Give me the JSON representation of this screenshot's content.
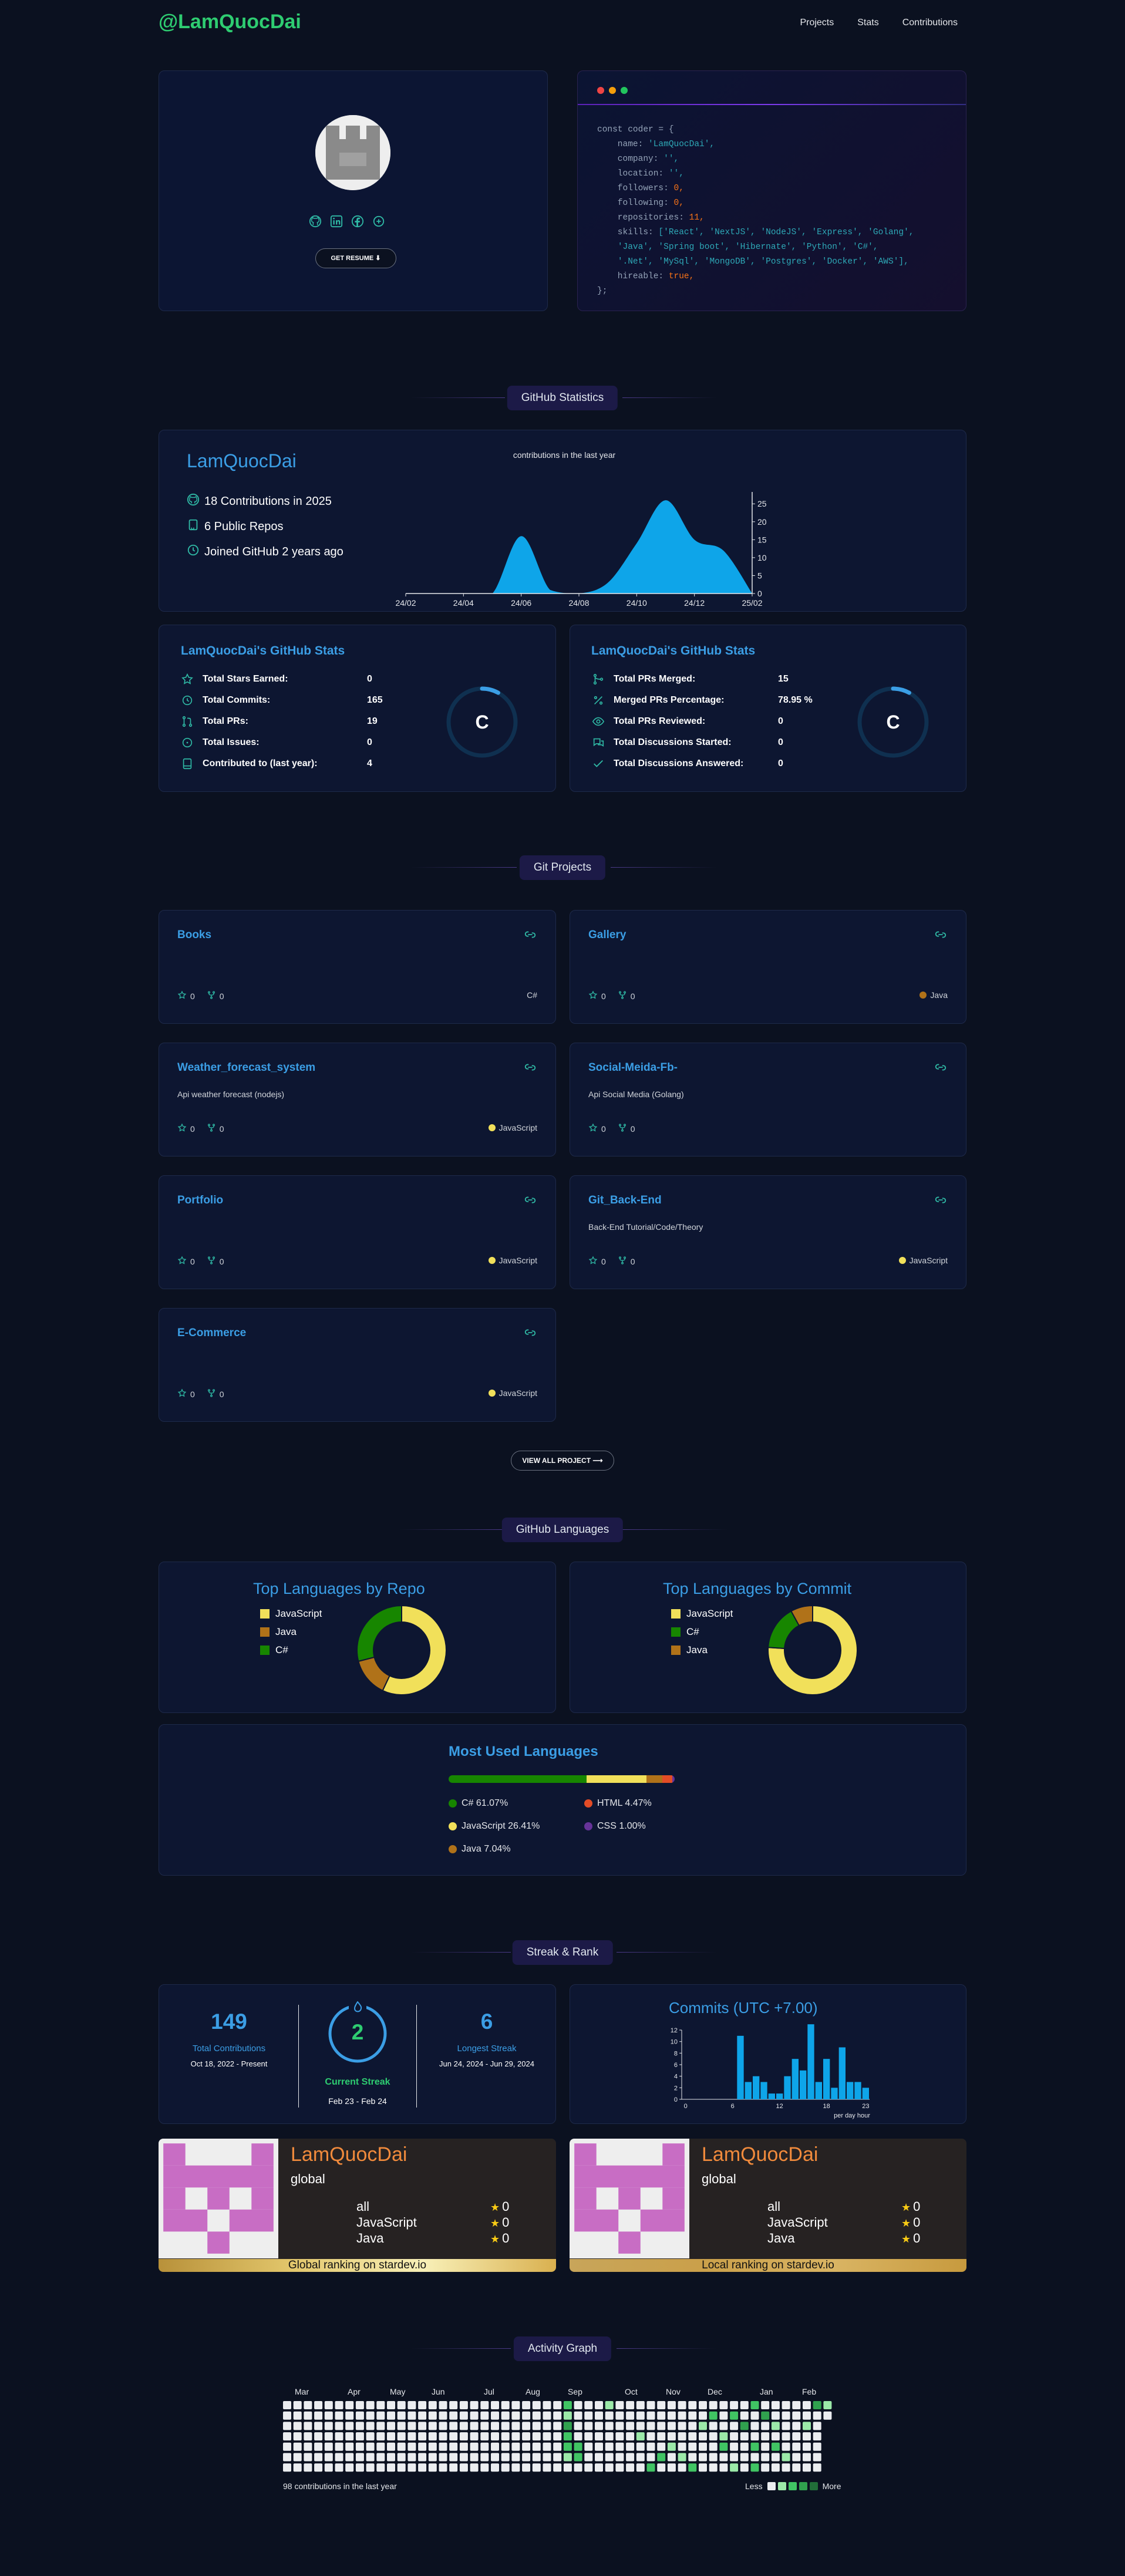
{
  "nav": {
    "logo": "@LamQuocDai",
    "links": [
      "Projects",
      "Stats",
      "Contributions"
    ]
  },
  "profile": {
    "resume_label": "GET RESUME",
    "socials": [
      "github-icon",
      "linkedin-icon",
      "facebook-icon",
      "stackoverflow-icon"
    ]
  },
  "code": {
    "lines": [
      {
        "k": "const coder = {"
      },
      {
        "k": "    name: ",
        "s": "'LamQuocDai',"
      },
      {
        "k": "    company: ",
        "s": "'',"
      },
      {
        "k": "    location: ",
        "s": "'',"
      },
      {
        "k": "    followers: ",
        "n": "0,"
      },
      {
        "k": "    following: ",
        "n": "0,"
      },
      {
        "k": "    repositories: ",
        "n": "11,"
      },
      {
        "k": "    skills: ",
        "s": "['React', 'NextJS', 'NodeJS', 'Express', 'Golang',"
      },
      {
        "k": "    ",
        "s": "'Java', 'Spring boot', 'Hibernate', 'Python', 'C#',"
      },
      {
        "k": "    ",
        "s": "'.Net', 'MySql', 'MongoDB', 'Postgres', 'Docker', 'AWS'],"
      },
      {
        "k": "    hireable: ",
        "n": "true,"
      },
      {
        "k": "};"
      }
    ]
  },
  "sections": {
    "stats": "GitHub Statistics",
    "projects": "Git Projects",
    "languages": "GitHub Languages",
    "streak": "Streak & Rank",
    "activity": "Activity Graph"
  },
  "summary": {
    "name": "LamQuocDai",
    "contributions": "18 Contributions in 2025",
    "repos": "6 Public Repos",
    "joined": "Joined GitHub 2 years ago"
  },
  "chart_data": [
    {
      "type": "area",
      "title": "contributions in the last year",
      "categories": [
        "24/02",
        "24/03",
        "24/04",
        "24/05",
        "24/06",
        "24/07",
        "24/08",
        "24/09",
        "24/10",
        "24/11",
        "24/12",
        "25/01",
        "25/02"
      ],
      "tick_labels": [
        "24/02",
        "24/04",
        "24/06",
        "24/08",
        "24/10",
        "24/12",
        "25/02"
      ],
      "values": [
        0,
        0,
        0,
        0,
        16,
        1,
        0,
        3,
        14,
        26,
        15,
        12,
        0
      ],
      "ylim": [
        0,
        27
      ],
      "yticks": [
        0,
        5,
        10,
        15,
        20,
        25
      ],
      "color": "#0ea5e9"
    },
    {
      "type": "pie",
      "title": "Top Languages by Repo",
      "labels": [
        "JavaScript",
        "Java",
        "C#"
      ],
      "values": [
        57,
        14,
        29
      ],
      "colors": [
        "#f1e05a",
        "#b07219",
        "#178600"
      ]
    },
    {
      "type": "pie",
      "title": "Top Languages by Commit",
      "labels": [
        "JavaScript",
        "C#",
        "Java"
      ],
      "values": [
        76,
        16,
        8
      ],
      "colors": [
        "#f1e05a",
        "#178600",
        "#b07219"
      ]
    },
    {
      "type": "bar",
      "title": "Commits (UTC +7.00)",
      "xlabel": "per day hour",
      "categories": [
        "0",
        "1",
        "2",
        "3",
        "4",
        "5",
        "6",
        "7",
        "8",
        "9",
        "10",
        "11",
        "12",
        "13",
        "14",
        "15",
        "16",
        "17",
        "18",
        "19",
        "20",
        "21",
        "22",
        "23"
      ],
      "tick_labels": [
        "0",
        "6",
        "12",
        "18",
        "23"
      ],
      "values": [
        0,
        0,
        0,
        0,
        0,
        0,
        0,
        11,
        3,
        4,
        3,
        1,
        1,
        4,
        7,
        5,
        13,
        3,
        7,
        2,
        9,
        3,
        3,
        2
      ],
      "ylim": [
        0,
        12
      ],
      "yticks": [
        0,
        2,
        4,
        6,
        8,
        10,
        12
      ],
      "color": "#0ea5e9"
    }
  ],
  "stats_left": {
    "title": "LamQuocDai's GitHub Stats",
    "rows": [
      {
        "icon": "star-icon",
        "label": "Total Stars Earned:",
        "value": "0"
      },
      {
        "icon": "history-icon",
        "label": "Total Commits:",
        "value": "165"
      },
      {
        "icon": "pull-request-icon",
        "label": "Total PRs:",
        "value": "19"
      },
      {
        "icon": "issue-icon",
        "label": "Total Issues:",
        "value": "0"
      },
      {
        "icon": "repo-icon",
        "label": "Contributed to (last year):",
        "value": "4"
      }
    ],
    "rank": "C",
    "rank_progress": 0.08
  },
  "stats_right": {
    "title": "LamQuocDai's GitHub Stats",
    "rows": [
      {
        "icon": "merge-icon",
        "label": "Total PRs Merged:",
        "value": "15"
      },
      {
        "icon": "percent-icon",
        "label": "Merged PRs Percentage:",
        "value": "78.95 %"
      },
      {
        "icon": "eye-icon",
        "label": "Total PRs Reviewed:",
        "value": "0"
      },
      {
        "icon": "discussion-icon",
        "label": "Total Discussions Started:",
        "value": "0"
      },
      {
        "icon": "check-icon",
        "label": "Total Discussions Answered:",
        "value": "0"
      }
    ],
    "rank": "C",
    "rank_progress": 0.08
  },
  "projects": [
    {
      "name": "Books",
      "desc": "",
      "stars": "0",
      "forks": "0",
      "lang": "C#",
      "color": ""
    },
    {
      "name": "Gallery",
      "desc": "",
      "stars": "0",
      "forks": "0",
      "lang": "Java",
      "color": "#b07219"
    },
    {
      "name": "Weather_forecast_system",
      "desc": "Api weather forecast (nodejs)",
      "stars": "0",
      "forks": "0",
      "lang": "JavaScript",
      "color": "#f1e05a"
    },
    {
      "name": "Social-Meida-Fb-",
      "desc": "Api Social Media (Golang)",
      "stars": "0",
      "forks": "0",
      "lang": "",
      "color": ""
    },
    {
      "name": "Portfolio",
      "desc": "",
      "stars": "0",
      "forks": "0",
      "lang": "JavaScript",
      "color": "#f1e05a"
    },
    {
      "name": "Git_Back-End",
      "desc": "Back-End Tutorial/Code/Theory",
      "stars": "0",
      "forks": "0",
      "lang": "JavaScript",
      "color": "#f1e05a"
    },
    {
      "name": "E-Commerce",
      "desc": "",
      "stars": "0",
      "forks": "0",
      "lang": "JavaScript",
      "color": "#f1e05a"
    }
  ],
  "view_all": "VIEW ALL PROJECT",
  "most_used": {
    "title": "Most Used Languages",
    "items": [
      {
        "name": "C# 61.07%",
        "value": 61.07,
        "color": "#178600"
      },
      {
        "name": "HTML 4.47%",
        "value": 4.47,
        "color": "#e34c26"
      },
      {
        "name": "JavaScript 26.41%",
        "value": 26.41,
        "color": "#f1e05a"
      },
      {
        "name": "CSS 1.00%",
        "value": 1.0,
        "color": "#663399"
      },
      {
        "name": "Java 7.04%",
        "value": 7.04,
        "color": "#b07219"
      }
    ]
  },
  "streak": {
    "total": "149",
    "total_label": "Total Contributions",
    "total_range": "Oct 18, 2022 - Present",
    "current": "2",
    "current_label": "Current Streak",
    "current_range": "Feb 23 - Feb 24",
    "longest": "6",
    "longest_label": "Longest Streak",
    "longest_range": "Jun 24, 2024 - Jun 29, 2024"
  },
  "rank_cards": [
    {
      "name": "LamQuocDai",
      "scope": "global",
      "rows": [
        {
          "label": "all",
          "value": "0"
        },
        {
          "label": "JavaScript",
          "value": "0"
        },
        {
          "label": "Java",
          "value": "0"
        }
      ],
      "footer": "Global ranking on stardev.io"
    },
    {
      "name": "LamQuocDai",
      "scope": "global",
      "rows": [
        {
          "label": "all",
          "value": "0"
        },
        {
          "label": "JavaScript",
          "value": "0"
        },
        {
          "label": "Java",
          "value": "0"
        }
      ],
      "footer": "Local ranking on stardev.io"
    }
  ],
  "activity": {
    "months": [
      "Mar",
      "Apr",
      "May",
      "Jun",
      "Jul",
      "Aug",
      "Sep",
      "Oct",
      "Nov",
      "Dec",
      "Jan",
      "Feb"
    ],
    "summary": "98 contributions in the last year",
    "less": "Less",
    "more": "More"
  }
}
